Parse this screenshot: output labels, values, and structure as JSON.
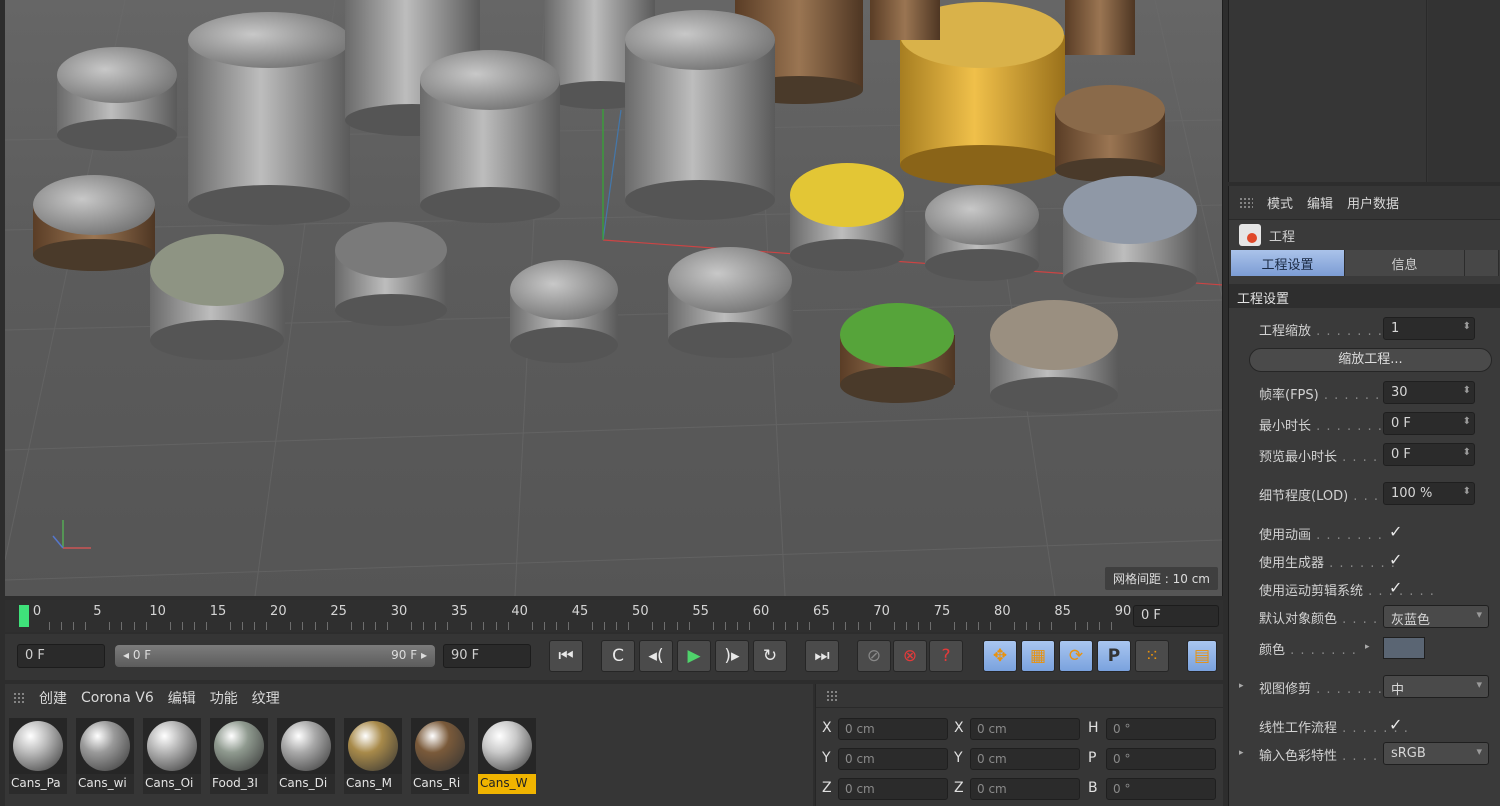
{
  "viewport": {
    "grid_spacing": "网格间距 : 10 cm"
  },
  "attributes": {
    "menu": [
      "模式",
      "编辑",
      "用户数据"
    ],
    "object_name": "工程",
    "tabs": [
      "工程设置",
      "信息",
      ""
    ],
    "section": "工程设置",
    "rows": {
      "scale": {
        "label": "工程缩放",
        "value": "1"
      },
      "scale_button": "缩放工程...",
      "fps": {
        "label": "帧率(FPS)",
        "value": "30"
      },
      "min_time": {
        "label": "最小时长",
        "value": "0 F"
      },
      "preview_min": {
        "label": "预览最小时长",
        "value": "0 F"
      },
      "lod": {
        "label": "细节程度(LOD)",
        "value": "100 %"
      },
      "use_animation": {
        "label": "使用动画",
        "check": "✓"
      },
      "use_generators": {
        "label": "使用生成器",
        "check": "✓"
      },
      "use_motion": {
        "label": "使用运动剪辑系统",
        "check": "✓"
      },
      "default_color": {
        "label": "默认对象颜色",
        "value": "灰蓝色"
      },
      "color": {
        "label": "颜色"
      },
      "view_clip": {
        "label": "视图修剪",
        "value": "中"
      },
      "linear": {
        "label": "线性工作流程",
        "check": "✓"
      },
      "input_profile": {
        "label": "输入色彩特性",
        "value": "sRGB"
      }
    }
  },
  "timeline": {
    "ticks": [
      "0",
      "5",
      "10",
      "15",
      "20",
      "25",
      "30",
      "35",
      "40",
      "45",
      "50",
      "55",
      "60",
      "65",
      "70",
      "75",
      "80",
      "85",
      "90"
    ],
    "current_frame": "0 F"
  },
  "transport": {
    "start": "0 F",
    "range_start": "◂ 0 F",
    "range_end": "90 F ▸",
    "end": "90 F",
    "icons": [
      "⏮",
      "C",
      "◂(",
      "▶",
      ")▸",
      "↻",
      "⏭",
      "⊘",
      "⊗",
      "?",
      "✥",
      "▦",
      "⟳",
      "P",
      "⁙",
      "▤"
    ]
  },
  "materials": {
    "menu": [
      "创建",
      "Corona V6",
      "编辑",
      "功能",
      "纹理"
    ],
    "items": [
      {
        "name": "Cans_Pa",
        "color": "#bcbcbc"
      },
      {
        "name": "Cans_wi",
        "color": "#9a9a9a"
      },
      {
        "name": "Cans_Oi",
        "color": "#b5b5b5"
      },
      {
        "name": "Food_3I",
        "color": "#8f9a8f"
      },
      {
        "name": "Cans_Di",
        "color": "#a9a9a9"
      },
      {
        "name": "Cans_M",
        "color": "#a88a4a"
      },
      {
        "name": "Cans_Ri",
        "color": "#7a5a3a"
      },
      {
        "name": "Cans_W",
        "color": "#c9c9c9"
      }
    ]
  },
  "coords": {
    "rows": [
      {
        "a": "X",
        "v": "0 cm",
        "b": "X",
        "w": "0 cm",
        "c": "H",
        "x": "0 °"
      },
      {
        "a": "Y",
        "v": "0 cm",
        "b": "Y",
        "w": "0 cm",
        "c": "P",
        "x": "0 °"
      },
      {
        "a": "Z",
        "v": "0 cm",
        "b": "Z",
        "w": "0 cm",
        "c": "B",
        "x": "0 °"
      }
    ]
  },
  "colors": {
    "accent_blue": "#7c9cd4",
    "playhead": "#3fe17a",
    "selected": "#f0b400"
  }
}
